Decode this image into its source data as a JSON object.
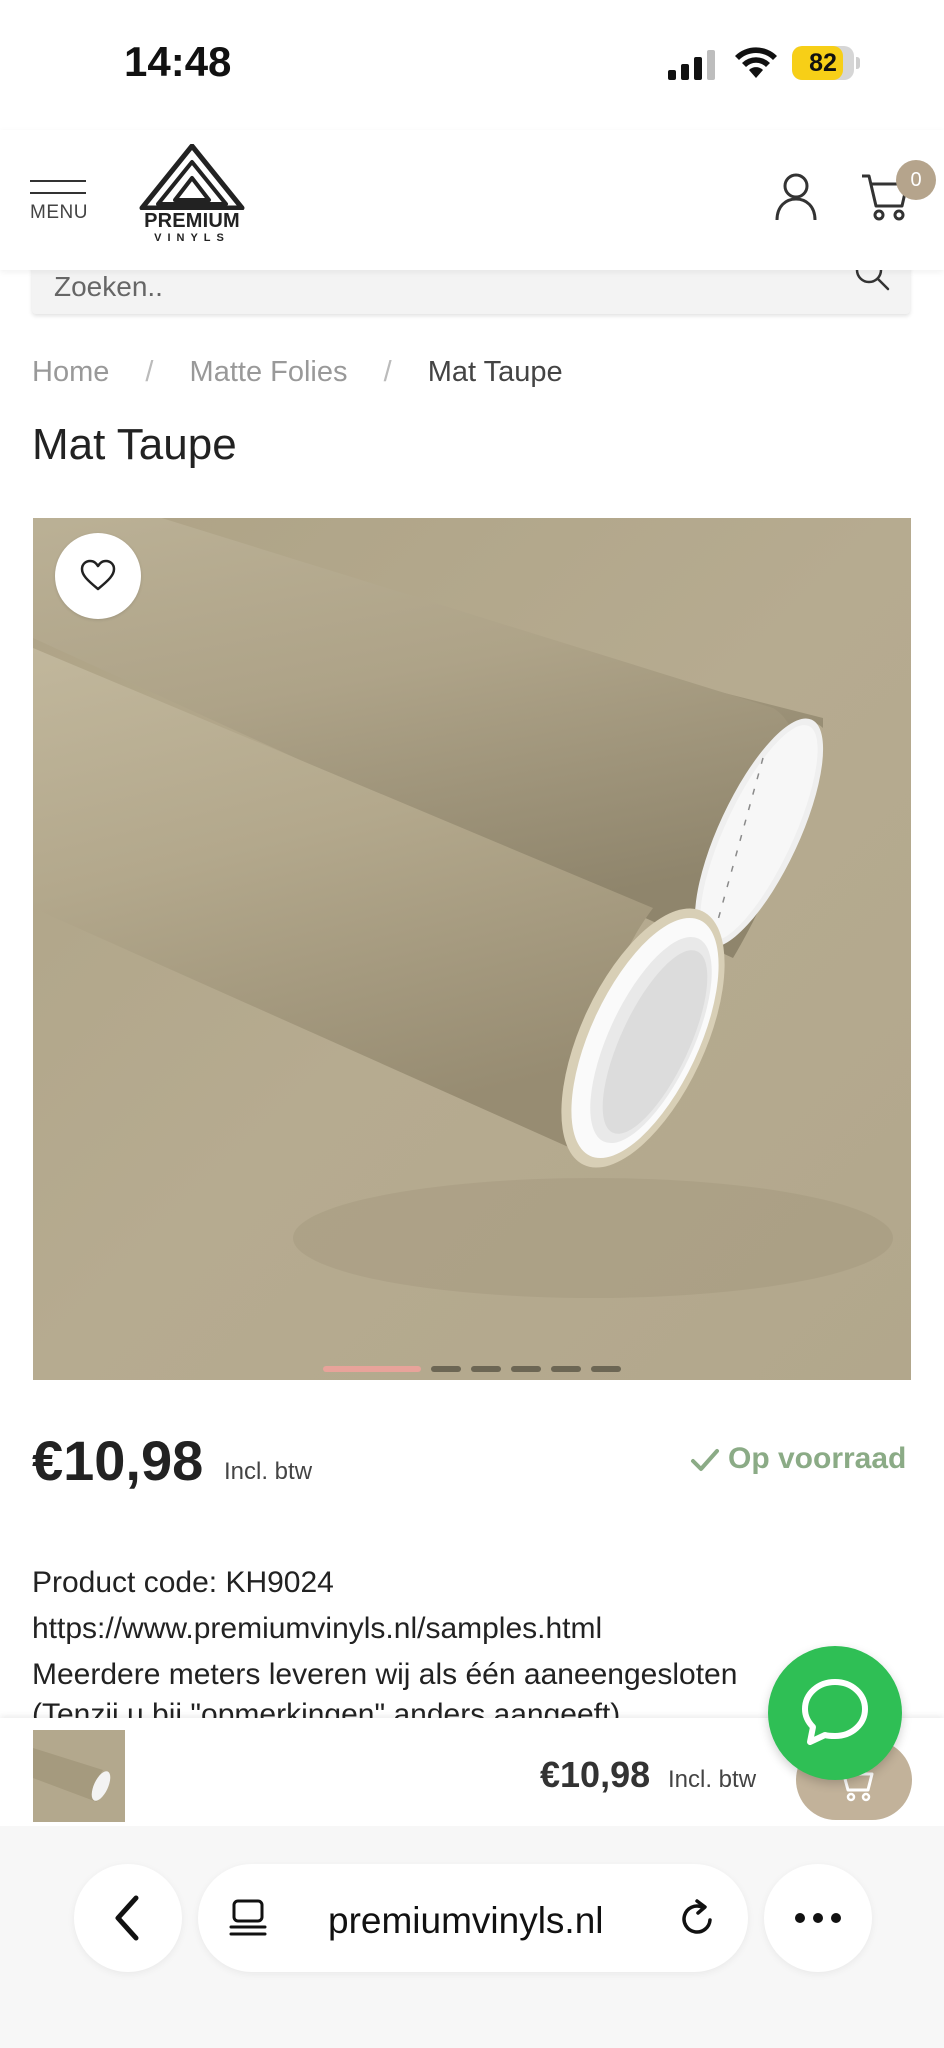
{
  "status_bar": {
    "time": "14:48",
    "battery_level": "82",
    "battery_color": "#f7cf17"
  },
  "header": {
    "menu_label": "MENU",
    "logo_text": "PREMIUM",
    "logo_subtext": "VINYLS",
    "cart_count": "0",
    "accent_color": "#b5a48c"
  },
  "search": {
    "placeholder": "Zoeken.."
  },
  "breadcrumb": {
    "items": [
      "Home",
      "Matte Folies",
      "Mat Taupe"
    ],
    "separator": "/"
  },
  "product": {
    "title": "Mat Taupe",
    "image_color": "#b3a88d",
    "image_count": 6,
    "active_image": 1,
    "price": "€10,98",
    "vat_label": "Incl. btw",
    "stock_label": "Op voorraad",
    "stock_color": "#8bab86",
    "description_lines": [
      "Product code: KH9024",
      "https://www.premiumvinyls.nl/samples.html",
      "Meerdere meters leveren wij als één aaneengesloten",
      "(Tenzij u bij \"opmerkingen\" anders aangeeft)"
    ]
  },
  "sticky_bar": {
    "price": "€10,98",
    "vat_label": "Incl. btw"
  },
  "chat": {
    "icon": "whatsapp-chat-icon",
    "color": "#2fbf55"
  },
  "browser": {
    "url": "premiumvinyls.nl"
  }
}
